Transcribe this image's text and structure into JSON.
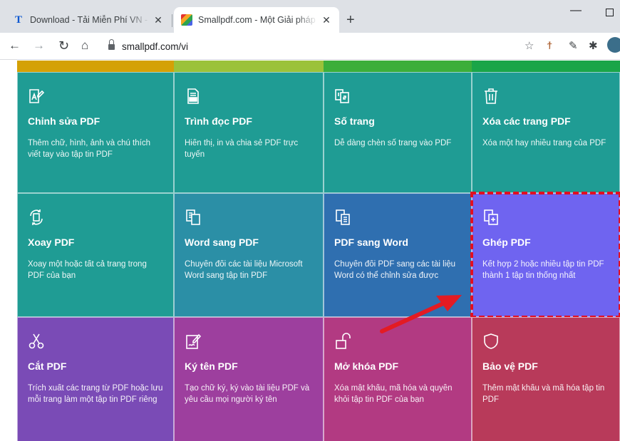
{
  "browser": {
    "tabs": [
      {
        "title": "Download - Tải Miễn Phí VN - Ph",
        "icon": "thuthuat-favicon",
        "active": false
      },
      {
        "title": "Smallpdf.com - Một Giải pháp M",
        "icon": "smallpdf-favicon",
        "active": true
      }
    ],
    "newtab_glyph": "+",
    "close_glyph": "✕",
    "url": "smallpdf.com/vi"
  },
  "colors": {
    "teal": "#1f9c94",
    "teal2": "#2b8fa6",
    "blue": "#2f6fb0",
    "purple_sel": "#6f64f0",
    "violet": "#7a4bb6",
    "magenta": "#9d3f9e",
    "pink": "#b23a82",
    "red": "#b83a5a",
    "arrow": "#e31b23",
    "strips": [
      "#d4a106",
      "#9bc23a",
      "#3cae3a",
      "#1aa548"
    ]
  },
  "tools": [
    {
      "name": "Chỉnh sửa PDF",
      "desc": "Thêm chữ, hình, ảnh và chú thích viết tay vào tập tin PDF",
      "icon": "edit-pdf-icon"
    },
    {
      "name": "Trình đọc PDF",
      "desc": "Hiển thị, in và chia sẻ PDF trực tuyến",
      "icon": "pdf-reader-icon"
    },
    {
      "name": "Số trang",
      "desc": "Dễ dàng chèn số trang vào PDF",
      "icon": "page-numbers-icon"
    },
    {
      "name": "Xóa các trang PDF",
      "desc": "Xóa một hay nhiều trang của PDF",
      "icon": "trash-icon"
    },
    {
      "name": "Xoay PDF",
      "desc": "Xoay một hoặc tất cả trang trong PDF của bạn",
      "icon": "rotate-icon"
    },
    {
      "name": "Word sang PDF",
      "desc": "Chuyển đổi các tài liệu Microsoft Word sang tập tin PDF",
      "icon": "word-to-pdf-icon"
    },
    {
      "name": "PDF sang Word",
      "desc": "Chuyển đổi PDF sang các tài liệu Word có thể chỉnh sửa được",
      "icon": "pdf-to-word-icon"
    },
    {
      "name": "Ghép PDF",
      "desc": "Kết hợp 2 hoặc nhiều tập tin PDF thành 1 tập tin thống nhất",
      "icon": "merge-pdf-icon"
    },
    {
      "name": "Cắt PDF",
      "desc": "Trích xuất các trang từ PDF hoặc lưu mỗi trang làm một tập tin PDF riêng",
      "icon": "scissors-icon"
    },
    {
      "name": "Ký tên PDF",
      "desc": "Tạo chữ ký, ký vào tài liệu PDF và yêu cầu mọi người ký tên",
      "icon": "sign-icon"
    },
    {
      "name": "Mở khóa PDF",
      "desc": "Xóa mật khẩu, mã hóa và quyền khỏi tập tin PDF của bạn",
      "icon": "unlock-icon"
    },
    {
      "name": "Bảo vệ PDF",
      "desc": "Thêm mật khẩu và mã hóa tập tin PDF",
      "icon": "shield-icon"
    }
  ]
}
